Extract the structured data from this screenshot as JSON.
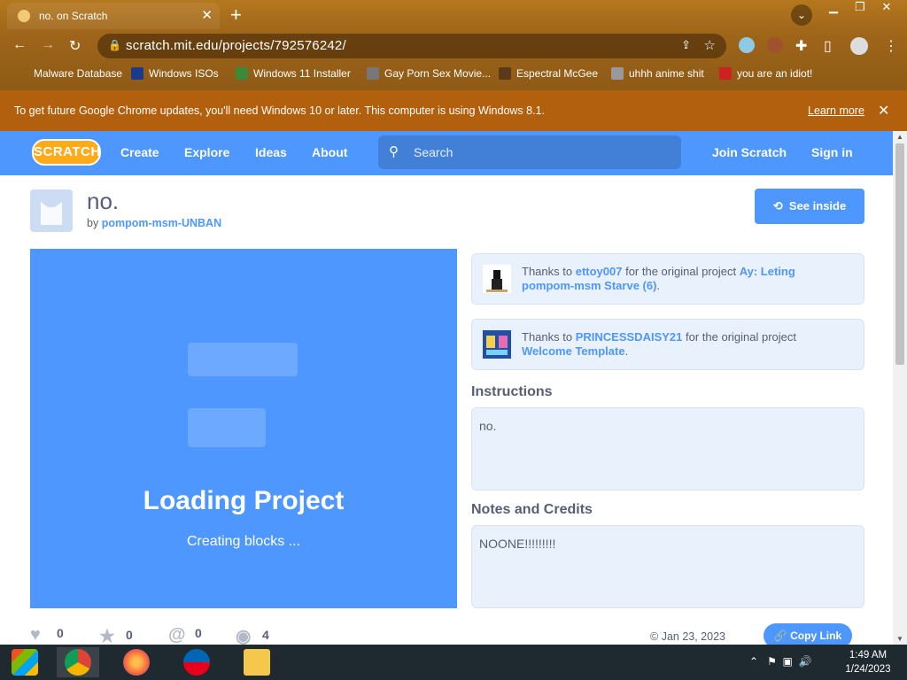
{
  "browser": {
    "tab_title": "no. on Scratch",
    "new_tab_symbol": "+",
    "close_symbol": "✕",
    "url": "scratch.mit.edu/projects/792576242/",
    "bookmarks": [
      {
        "label": "Malware Database",
        "color": "#7a5a2a"
      },
      {
        "label": "Windows ISOs",
        "color": "#1d3a8a"
      },
      {
        "label": "Windows 11 Installer",
        "color": "#3a8a3a"
      },
      {
        "label": "Gay Porn Sex Movie...",
        "color": "#777777"
      },
      {
        "label": "Espectral McGee",
        "color": "#5a3a1a"
      },
      {
        "label": "uhhh anime shit",
        "color": "#999999"
      },
      {
        "label": "you are an idiot!",
        "color": "#cc2222"
      }
    ]
  },
  "infobar": {
    "message": "To get future Google Chrome updates, you'll need Windows 10 or later. This computer is using Windows 8.1.",
    "learn_more": "Learn more"
  },
  "scratch_nav": {
    "logo": "SCRATCH",
    "links": [
      "Create",
      "Explore",
      "Ideas",
      "About"
    ],
    "search_placeholder": "Search",
    "join": "Join Scratch",
    "sign_in": "Sign in"
  },
  "project": {
    "title": "no.",
    "by_prefix": "by",
    "author": "pompom-msm-UNBAN",
    "see_inside": "See inside",
    "loading_title": "Loading Project",
    "loading_status": "Creating blocks ...",
    "remixes": [
      {
        "prefix": "Thanks to",
        "user": "ettoy007",
        "middle": "for the original project",
        "project": "Ay: Leting pompom-msm Starve (6)",
        "suffix": "."
      },
      {
        "prefix": "Thanks to",
        "user": "PRINCESSDAISY21",
        "middle": "for the original project",
        "project": "Welcome Template",
        "suffix": "."
      }
    ],
    "instructions_heading": "Instructions",
    "instructions": "no.",
    "notes_heading": "Notes and Credits",
    "notes": "NOONE!!!!!!!!!",
    "stats": {
      "loves": "0",
      "favorites": "0",
      "remixes": "0",
      "views": "4"
    },
    "date": "Jan 23, 2023",
    "copy_link": "Copy Link"
  },
  "taskbar": {
    "time": "1:49 AM",
    "date": "1/24/2023"
  }
}
